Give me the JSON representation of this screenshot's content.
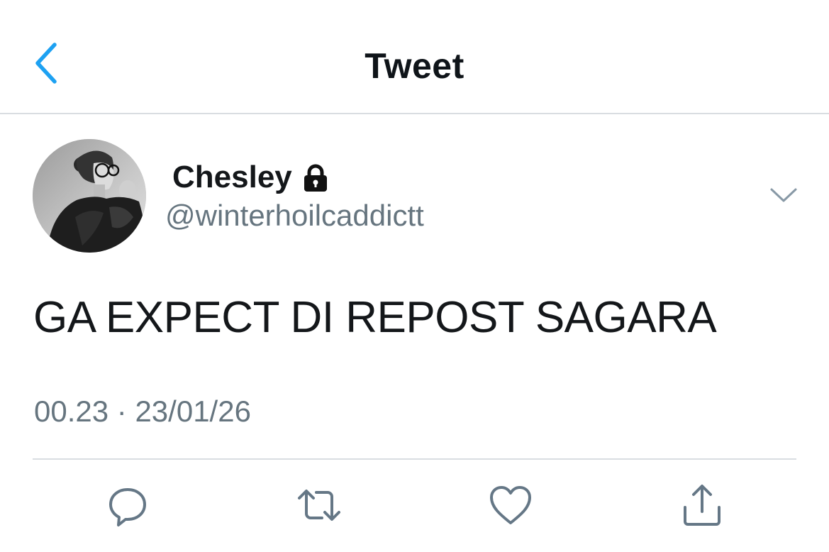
{
  "nav": {
    "title": "Tweet",
    "back_icon": "chevron-left-icon",
    "accent": "#1da1f2"
  },
  "author": {
    "display_name": "Chesley",
    "handle": "@winterhoilcaddictt",
    "protected_icon": "lock-icon",
    "avatar_icon": "profile-photo"
  },
  "tweet": {
    "text": "GA EXPECT DI REPOST SAGARA",
    "time": "00.23",
    "separator": "·",
    "date": "23/01/26"
  },
  "actions": [
    {
      "icon": "reply-icon"
    },
    {
      "icon": "retweet-icon"
    },
    {
      "icon": "like-icon"
    },
    {
      "icon": "share-icon"
    }
  ],
  "colors": {
    "text": "#14171a",
    "secondary": "#66757f",
    "divider": "#d9dde1"
  }
}
